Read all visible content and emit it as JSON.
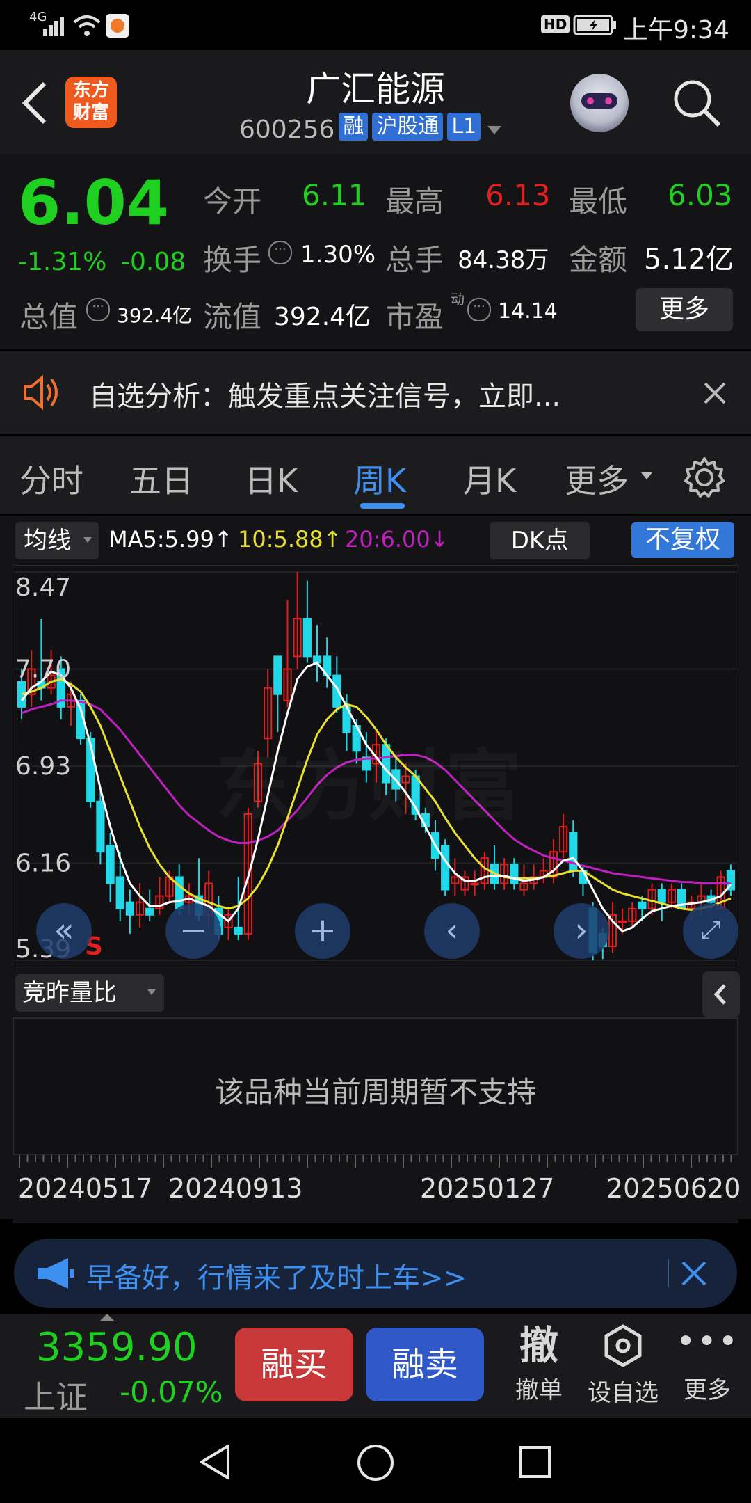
{
  "status": {
    "network": "4G",
    "time": "上午9:34",
    "hd": "HD"
  },
  "header": {
    "logo": "东方财富",
    "title": "广汇能源",
    "code": "600256",
    "tags": [
      "融",
      "沪股通",
      "L1"
    ]
  },
  "quote": {
    "price": "6.04",
    "change_pct": "-1.31%",
    "change": "-0.08",
    "open_label": "今开",
    "open": "6.11",
    "high_label": "最高",
    "high": "6.13",
    "low_label": "最低",
    "low": "6.03",
    "turnover_label": "换手",
    "turnover": "1.30%",
    "volume_label": "总手",
    "volume": "84.38万",
    "amount_label": "金额",
    "amount": "5.12亿",
    "mktcap_label": "总值",
    "mktcap": "392.4亿",
    "float_label": "流值",
    "float": "392.4亿",
    "pe_label": "市盈",
    "pe_sup": "动",
    "pe": "14.14",
    "more": "更多"
  },
  "notice": {
    "text": "自选分析：触发重点关注信号，立即..."
  },
  "tabs": [
    "分时",
    "五日",
    "日K",
    "周K",
    "月K",
    "更多"
  ],
  "active_tab": "周K",
  "ma": {
    "selector": "均线",
    "ma5": "MA5:5.99↑",
    "ma10": "10:5.88↑",
    "ma20": "20:6.00↓",
    "dk": "DK点",
    "fq": "不复权"
  },
  "colors": {
    "up": "#e02020",
    "down": "#20d8e8",
    "ma5": "#ffffff",
    "ma10": "#e8e030",
    "ma20": "#c020c0",
    "accent": "#3d8ff0"
  },
  "chart_data": {
    "type": "candlestick",
    "y_ticks": [
      "8.47",
      "7.70",
      "6.93",
      "6.16",
      "5.39"
    ],
    "ylim": [
      5.39,
      8.47
    ],
    "x_ticks": [
      "20240517",
      "20240913",
      "20250127",
      "20250620"
    ],
    "signal_label": "S",
    "candles": [
      [
        7.6,
        7.4,
        7.7,
        7.3
      ],
      [
        7.5,
        7.7,
        7.85,
        7.4
      ],
      [
        7.6,
        7.55,
        8.1,
        7.45
      ],
      [
        7.55,
        7.65,
        7.85,
        7.5
      ],
      [
        7.7,
        7.4,
        7.8,
        7.3
      ],
      [
        7.4,
        7.5,
        7.6,
        7.25
      ],
      [
        7.45,
        7.15,
        7.5,
        7.1
      ],
      [
        7.15,
        6.65,
        7.2,
        6.6
      ],
      [
        6.65,
        6.25,
        6.75,
        6.15
      ],
      [
        6.3,
        6.0,
        6.4,
        5.85
      ],
      [
        6.05,
        5.8,
        6.25,
        5.7
      ],
      [
        5.85,
        5.75,
        5.95,
        5.6
      ],
      [
        5.75,
        5.85,
        6.0,
        5.65
      ],
      [
        5.8,
        5.75,
        5.95,
        5.7
      ],
      [
        5.8,
        5.9,
        6.05,
        5.75
      ],
      [
        5.9,
        6.05,
        6.1,
        5.85
      ],
      [
        6.05,
        5.8,
        6.15,
        5.75
      ],
      [
        5.85,
        5.9,
        6.0,
        5.75
      ],
      [
        5.9,
        5.75,
        6.2,
        5.7
      ],
      [
        5.75,
        6.0,
        6.1,
        5.65
      ],
      [
        5.8,
        5.6,
        5.9,
        5.55
      ],
      [
        5.65,
        5.75,
        5.8,
        5.55
      ],
      [
        5.65,
        5.6,
        6.05,
        5.55
      ],
      [
        5.6,
        6.55,
        6.6,
        5.55
      ],
      [
        6.65,
        6.95,
        7.05,
        6.6
      ],
      [
        7.15,
        7.55,
        7.7,
        7.0
      ],
      [
        7.8,
        7.5,
        7.8,
        7.2
      ],
      [
        7.45,
        7.7,
        8.25,
        7.4
      ],
      [
        7.8,
        8.1,
        8.47,
        7.7
      ],
      [
        8.1,
        7.8,
        8.4,
        7.75
      ],
      [
        7.8,
        7.75,
        8.05,
        7.6
      ],
      [
        7.8,
        7.65,
        7.95,
        7.55
      ],
      [
        7.65,
        7.4,
        7.8,
        7.35
      ],
      [
        7.4,
        7.2,
        7.5,
        7.05
      ],
      [
        7.25,
        7.05,
        7.3,
        6.95
      ],
      [
        7.0,
        6.9,
        7.2,
        6.8
      ],
      [
        6.95,
        7.1,
        7.2,
        6.8
      ],
      [
        7.1,
        6.8,
        7.15,
        6.7
      ],
      [
        6.9,
        6.75,
        7.0,
        6.65
      ],
      [
        6.8,
        6.85,
        6.95,
        6.55
      ],
      [
        6.85,
        6.55,
        6.9,
        6.5
      ],
      [
        6.55,
        6.45,
        6.6,
        6.4
      ],
      [
        6.4,
        6.2,
        6.5,
        6.1
      ],
      [
        6.3,
        5.95,
        6.35,
        5.9
      ],
      [
        6.0,
        6.05,
        6.2,
        5.9
      ],
      [
        5.95,
        6.05,
        6.1,
        5.9
      ],
      [
        6.0,
        6.0,
        6.1,
        5.9
      ],
      [
        6.0,
        6.2,
        6.25,
        5.95
      ],
      [
        6.15,
        6.0,
        6.3,
        5.95
      ],
      [
        6.0,
        6.15,
        6.2,
        5.95
      ],
      [
        6.15,
        6.0,
        6.2,
        5.95
      ],
      [
        5.95,
        6.0,
        6.15,
        5.9
      ],
      [
        6.0,
        6.05,
        6.15,
        5.95
      ],
      [
        6.05,
        6.1,
        6.2,
        6.0
      ],
      [
        6.05,
        6.25,
        6.35,
        6.0
      ],
      [
        6.25,
        6.45,
        6.55,
        6.2
      ],
      [
        6.4,
        6.1,
        6.5,
        6.05
      ],
      [
        6.1,
        6.0,
        6.15,
        5.9
      ],
      [
        5.8,
        5.45,
        5.85,
        5.39
      ],
      [
        5.6,
        5.5,
        5.65,
        5.4
      ],
      [
        5.5,
        5.75,
        5.85,
        5.45
      ],
      [
        5.7,
        5.7,
        5.8,
        5.6
      ],
      [
        5.7,
        5.8,
        5.85,
        5.65
      ],
      [
        5.85,
        5.8,
        5.9,
        5.7
      ],
      [
        5.8,
        5.95,
        6.0,
        5.75
      ],
      [
        5.95,
        5.85,
        6.0,
        5.7
      ],
      [
        5.85,
        5.95,
        6.0,
        5.8
      ],
      [
        5.95,
        5.8,
        6.0,
        5.8
      ],
      [
        5.8,
        5.85,
        5.9,
        5.7
      ],
      [
        5.85,
        5.9,
        6.0,
        5.75
      ],
      [
        5.9,
        5.85,
        5.95,
        5.8
      ],
      [
        5.8,
        6.05,
        6.1,
        5.8
      ],
      [
        6.1,
        5.95,
        6.15,
        5.9
      ]
    ],
    "ma5": [
      7.45,
      7.55,
      7.6,
      7.68,
      7.65,
      7.55,
      7.38,
      7.1,
      6.75,
      6.45,
      6.2,
      6.0,
      5.9,
      5.82,
      5.82,
      5.85,
      5.86,
      5.88,
      5.85,
      5.82,
      5.76,
      5.7,
      5.8,
      6.05,
      6.35,
      6.7,
      7.05,
      7.35,
      7.62,
      7.72,
      7.75,
      7.65,
      7.55,
      7.4,
      7.25,
      7.1,
      7.0,
      6.9,
      6.82,
      6.72,
      6.6,
      6.45,
      6.3,
      6.18,
      6.08,
      6.02,
      6.02,
      6.05,
      6.06,
      6.06,
      6.04,
      6.02,
      6.03,
      6.05,
      6.1,
      6.18,
      6.2,
      6.1,
      5.95,
      5.8,
      5.7,
      5.62,
      5.65,
      5.72,
      5.78,
      5.8,
      5.82,
      5.83,
      5.84,
      5.85,
      5.87,
      5.9,
      5.99
    ],
    "ma10": [
      7.5,
      7.52,
      7.55,
      7.6,
      7.62,
      7.58,
      7.52,
      7.4,
      7.25,
      7.05,
      6.85,
      6.65,
      6.45,
      6.28,
      6.15,
      6.05,
      5.98,
      5.92,
      5.88,
      5.85,
      5.82,
      5.8,
      5.82,
      5.88,
      5.98,
      6.12,
      6.3,
      6.52,
      6.75,
      6.98,
      7.18,
      7.3,
      7.38,
      7.42,
      7.4,
      7.32,
      7.22,
      7.1,
      7.0,
      6.92,
      6.85,
      6.75,
      6.65,
      6.52,
      6.4,
      6.3,
      6.2,
      6.12,
      6.08,
      6.05,
      6.04,
      6.04,
      6.04,
      6.05,
      6.06,
      6.08,
      6.1,
      6.1,
      6.05,
      6.0,
      5.95,
      5.92,
      5.9,
      5.88,
      5.86,
      5.84,
      5.82,
      5.8,
      5.79,
      5.8,
      5.82,
      5.85,
      5.88
    ],
    "ma20": [
      7.35,
      7.38,
      7.4,
      7.42,
      7.45,
      7.45,
      7.44,
      7.42,
      7.38,
      7.3,
      7.22,
      7.12,
      7.02,
      6.92,
      6.82,
      6.72,
      6.62,
      6.54,
      6.48,
      6.42,
      6.37,
      6.34,
      6.32,
      6.32,
      6.34,
      6.37,
      6.42,
      6.5,
      6.58,
      6.68,
      6.78,
      6.86,
      6.92,
      6.96,
      6.98,
      6.99,
      6.99,
      7.0,
      7.01,
      7.02,
      7.02,
      7.0,
      6.96,
      6.9,
      6.82,
      6.74,
      6.66,
      6.58,
      6.5,
      6.42,
      6.35,
      6.3,
      6.26,
      6.22,
      6.2,
      6.18,
      6.16,
      6.14,
      6.12,
      6.1,
      6.08,
      6.07,
      6.06,
      6.05,
      6.04,
      6.03,
      6.02,
      6.01,
      6.01,
      6.0,
      6.0,
      6.0,
      6.0
    ]
  },
  "volume_panel": {
    "selector": "竞昨量比",
    "message": "该品种当前周期暂不支持"
  },
  "banner": {
    "text": "早备好，行情来了及时上车>>"
  },
  "bottom": {
    "index_value": "3359.90",
    "index_name": "上证",
    "index_change": "-0.07%",
    "buy": "融买",
    "sell": "融卖",
    "cancel_icon": "撤",
    "cancel": "撤单",
    "watch": "设自选",
    "more": "更多"
  }
}
